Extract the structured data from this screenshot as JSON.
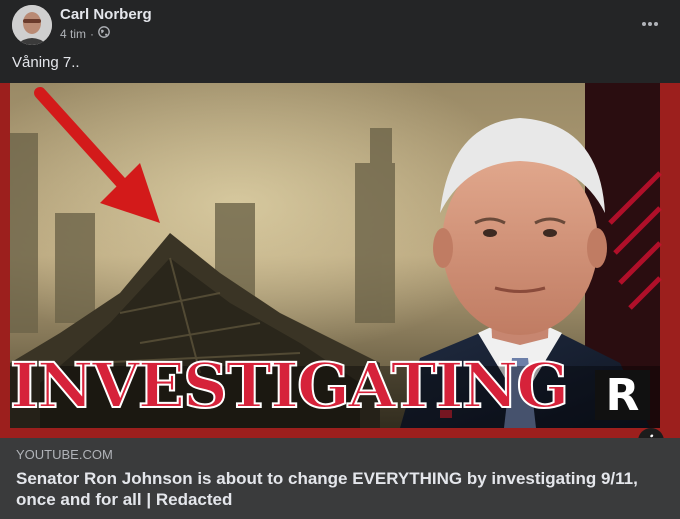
{
  "post": {
    "author": "Carl Norberg",
    "time": "4 tim",
    "separator": "·",
    "text": "Våning 7.."
  },
  "video": {
    "overlay_text": "INVESTIGATING",
    "channel_logo": "R"
  },
  "link": {
    "domain": "YOUTUBE.COM",
    "title": "Senator Ron Johnson is about to change EVERYTHING by investigating 9/11, once and for all | Redacted"
  },
  "icons": {
    "privacy": "globe-icon",
    "menu": "more-options-icon",
    "info": "info-icon"
  },
  "colors": {
    "background": "#242526",
    "link_box": "#3a3b3c",
    "text": "#e4e6eb",
    "secondary_text": "#b0b3b8",
    "accent_red": "#c8102e"
  }
}
